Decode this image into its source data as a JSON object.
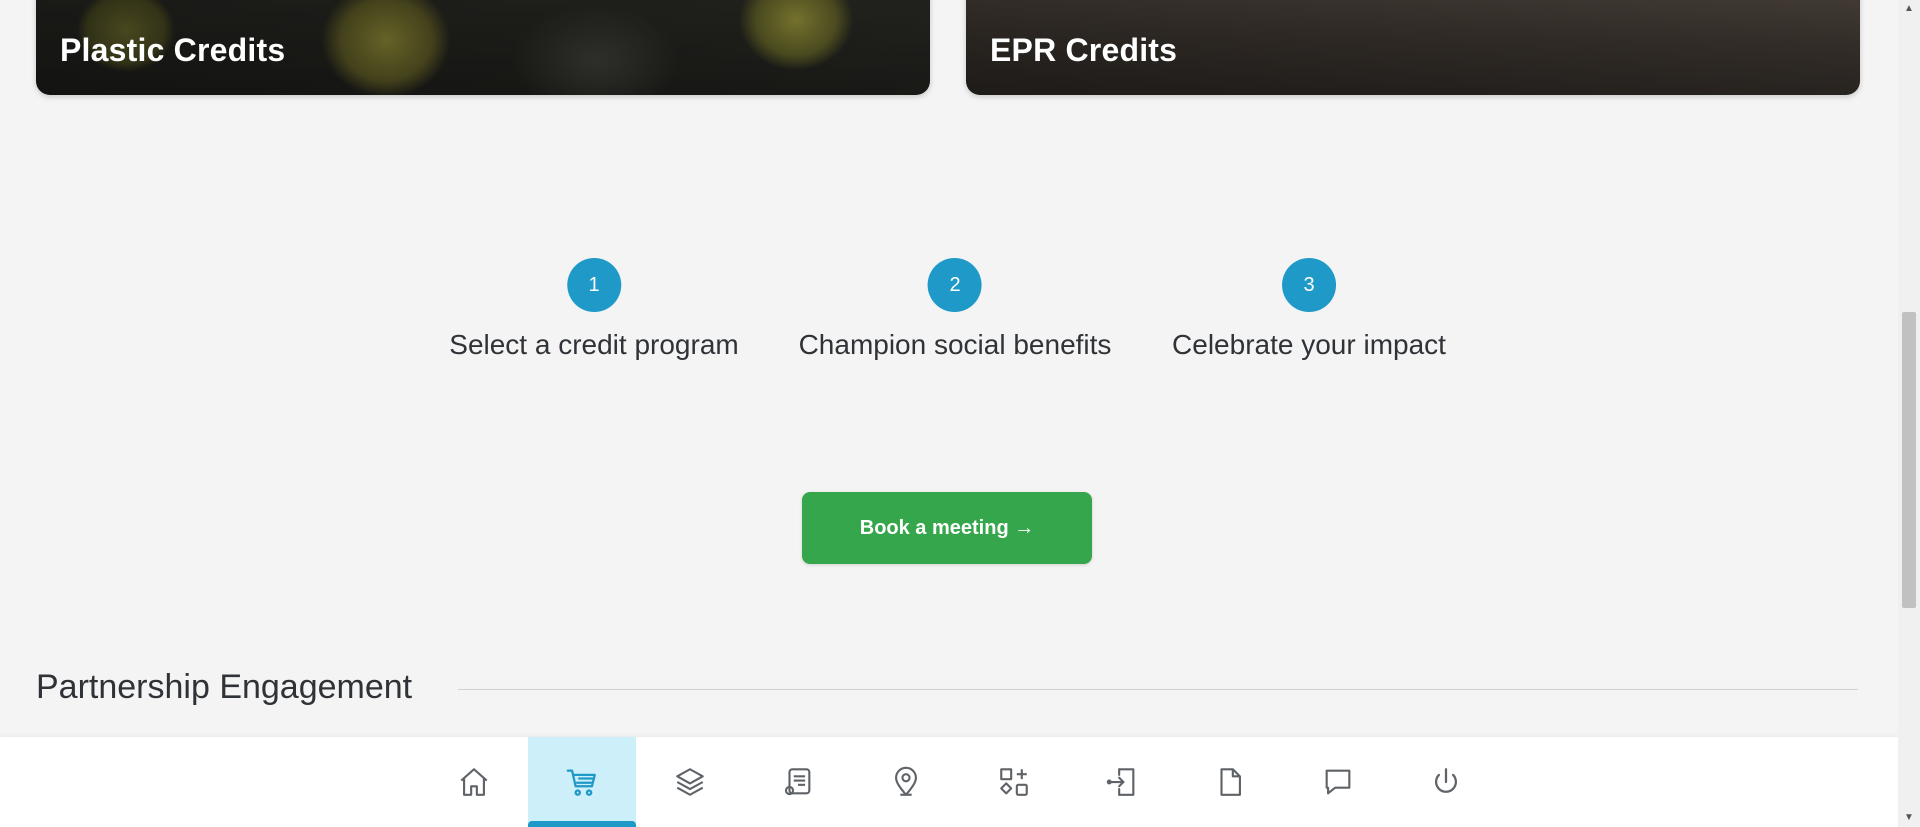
{
  "cards": [
    {
      "title": "Plastic Credits"
    },
    {
      "title": "EPR Credits"
    }
  ],
  "steps": [
    {
      "number": "1",
      "label": "Select a credit program"
    },
    {
      "number": "2",
      "label": "Champion social benefits"
    },
    {
      "number": "3",
      "label": "Celebrate your impact"
    }
  ],
  "cta": {
    "label": "Book a meeting →"
  },
  "section": {
    "title": "Partnership Engagement"
  },
  "bottom_nav": {
    "active": "cart",
    "items": [
      {
        "icon": "home-icon"
      },
      {
        "icon": "cart-icon"
      },
      {
        "icon": "layers-icon"
      },
      {
        "icon": "certificate-icon"
      },
      {
        "icon": "map-pin-icon"
      },
      {
        "icon": "shapes-icon"
      },
      {
        "icon": "login-icon"
      },
      {
        "icon": "document-icon"
      },
      {
        "icon": "chat-icon"
      },
      {
        "icon": "power-icon"
      }
    ]
  },
  "colors": {
    "accent": "#1f9ac8",
    "cta_green": "#35a64b",
    "active_nav_bg": "#cdeff9",
    "background": "#f4f4f4"
  }
}
